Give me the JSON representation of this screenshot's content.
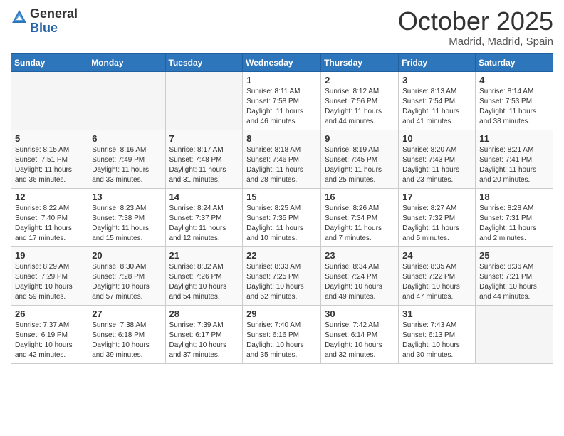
{
  "header": {
    "logo_general": "General",
    "logo_blue": "Blue",
    "month": "October 2025",
    "location": "Madrid, Madrid, Spain"
  },
  "weekdays": [
    "Sunday",
    "Monday",
    "Tuesday",
    "Wednesday",
    "Thursday",
    "Friday",
    "Saturday"
  ],
  "weeks": [
    [
      {
        "day": "",
        "info": ""
      },
      {
        "day": "",
        "info": ""
      },
      {
        "day": "",
        "info": ""
      },
      {
        "day": "1",
        "info": "Sunrise: 8:11 AM\nSunset: 7:58 PM\nDaylight: 11 hours\nand 46 minutes."
      },
      {
        "day": "2",
        "info": "Sunrise: 8:12 AM\nSunset: 7:56 PM\nDaylight: 11 hours\nand 44 minutes."
      },
      {
        "day": "3",
        "info": "Sunrise: 8:13 AM\nSunset: 7:54 PM\nDaylight: 11 hours\nand 41 minutes."
      },
      {
        "day": "4",
        "info": "Sunrise: 8:14 AM\nSunset: 7:53 PM\nDaylight: 11 hours\nand 38 minutes."
      }
    ],
    [
      {
        "day": "5",
        "info": "Sunrise: 8:15 AM\nSunset: 7:51 PM\nDaylight: 11 hours\nand 36 minutes."
      },
      {
        "day": "6",
        "info": "Sunrise: 8:16 AM\nSunset: 7:49 PM\nDaylight: 11 hours\nand 33 minutes."
      },
      {
        "day": "7",
        "info": "Sunrise: 8:17 AM\nSunset: 7:48 PM\nDaylight: 11 hours\nand 31 minutes."
      },
      {
        "day": "8",
        "info": "Sunrise: 8:18 AM\nSunset: 7:46 PM\nDaylight: 11 hours\nand 28 minutes."
      },
      {
        "day": "9",
        "info": "Sunrise: 8:19 AM\nSunset: 7:45 PM\nDaylight: 11 hours\nand 25 minutes."
      },
      {
        "day": "10",
        "info": "Sunrise: 8:20 AM\nSunset: 7:43 PM\nDaylight: 11 hours\nand 23 minutes."
      },
      {
        "day": "11",
        "info": "Sunrise: 8:21 AM\nSunset: 7:41 PM\nDaylight: 11 hours\nand 20 minutes."
      }
    ],
    [
      {
        "day": "12",
        "info": "Sunrise: 8:22 AM\nSunset: 7:40 PM\nDaylight: 11 hours\nand 17 minutes."
      },
      {
        "day": "13",
        "info": "Sunrise: 8:23 AM\nSunset: 7:38 PM\nDaylight: 11 hours\nand 15 minutes."
      },
      {
        "day": "14",
        "info": "Sunrise: 8:24 AM\nSunset: 7:37 PM\nDaylight: 11 hours\nand 12 minutes."
      },
      {
        "day": "15",
        "info": "Sunrise: 8:25 AM\nSunset: 7:35 PM\nDaylight: 11 hours\nand 10 minutes."
      },
      {
        "day": "16",
        "info": "Sunrise: 8:26 AM\nSunset: 7:34 PM\nDaylight: 11 hours\nand 7 minutes."
      },
      {
        "day": "17",
        "info": "Sunrise: 8:27 AM\nSunset: 7:32 PM\nDaylight: 11 hours\nand 5 minutes."
      },
      {
        "day": "18",
        "info": "Sunrise: 8:28 AM\nSunset: 7:31 PM\nDaylight: 11 hours\nand 2 minutes."
      }
    ],
    [
      {
        "day": "19",
        "info": "Sunrise: 8:29 AM\nSunset: 7:29 PM\nDaylight: 10 hours\nand 59 minutes."
      },
      {
        "day": "20",
        "info": "Sunrise: 8:30 AM\nSunset: 7:28 PM\nDaylight: 10 hours\nand 57 minutes."
      },
      {
        "day": "21",
        "info": "Sunrise: 8:32 AM\nSunset: 7:26 PM\nDaylight: 10 hours\nand 54 minutes."
      },
      {
        "day": "22",
        "info": "Sunrise: 8:33 AM\nSunset: 7:25 PM\nDaylight: 10 hours\nand 52 minutes."
      },
      {
        "day": "23",
        "info": "Sunrise: 8:34 AM\nSunset: 7:24 PM\nDaylight: 10 hours\nand 49 minutes."
      },
      {
        "day": "24",
        "info": "Sunrise: 8:35 AM\nSunset: 7:22 PM\nDaylight: 10 hours\nand 47 minutes."
      },
      {
        "day": "25",
        "info": "Sunrise: 8:36 AM\nSunset: 7:21 PM\nDaylight: 10 hours\nand 44 minutes."
      }
    ],
    [
      {
        "day": "26",
        "info": "Sunrise: 7:37 AM\nSunset: 6:19 PM\nDaylight: 10 hours\nand 42 minutes."
      },
      {
        "day": "27",
        "info": "Sunrise: 7:38 AM\nSunset: 6:18 PM\nDaylight: 10 hours\nand 39 minutes."
      },
      {
        "day": "28",
        "info": "Sunrise: 7:39 AM\nSunset: 6:17 PM\nDaylight: 10 hours\nand 37 minutes."
      },
      {
        "day": "29",
        "info": "Sunrise: 7:40 AM\nSunset: 6:16 PM\nDaylight: 10 hours\nand 35 minutes."
      },
      {
        "day": "30",
        "info": "Sunrise: 7:42 AM\nSunset: 6:14 PM\nDaylight: 10 hours\nand 32 minutes."
      },
      {
        "day": "31",
        "info": "Sunrise: 7:43 AM\nSunset: 6:13 PM\nDaylight: 10 hours\nand 30 minutes."
      },
      {
        "day": "",
        "info": ""
      }
    ]
  ]
}
